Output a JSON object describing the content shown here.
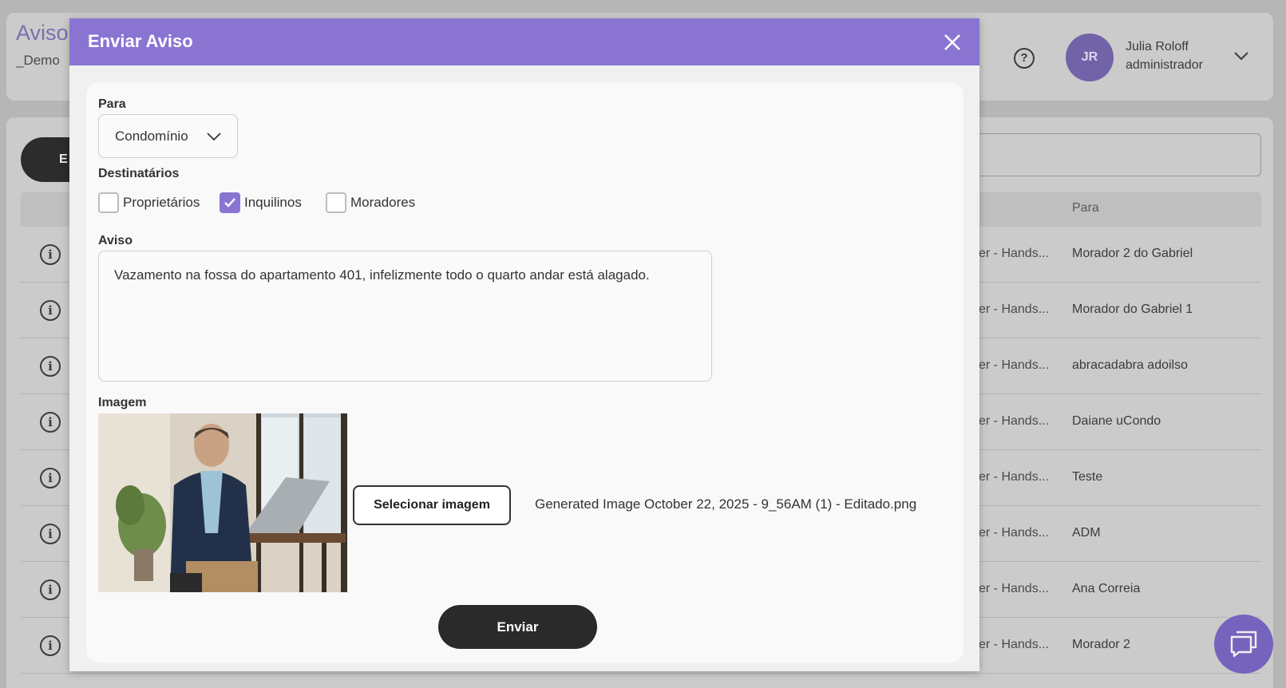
{
  "app": {
    "page_title": "Aviso",
    "subtitle": "_Demo",
    "help_icon": "question-circle-icon",
    "user": {
      "initials": "JR",
      "name": "Julia Roloff",
      "role": "administrador"
    },
    "action_button_label": "E",
    "table": {
      "header_para": "Para",
      "rows": [
        {
          "desc": "er - Hands...",
          "para": "Morador 2 do Gabriel"
        },
        {
          "desc": "er - Hands...",
          "para": "Morador do Gabriel 1"
        },
        {
          "desc": "er - Hands...",
          "para": "abracadabra adoilso"
        },
        {
          "desc": "er - Hands...",
          "para": "Daiane uCondo"
        },
        {
          "desc": "er - Hands...",
          "para": "Teste"
        },
        {
          "desc": "er - Hands...",
          "para": "ADM"
        },
        {
          "desc": "er - Hands...",
          "para": "Ana Correia"
        },
        {
          "desc": "er - Hands...",
          "para": "Morador 2"
        }
      ]
    },
    "chat_icon": "chat-bubbles-icon"
  },
  "modal": {
    "title": "Enviar Aviso",
    "close_icon": "close-icon",
    "para": {
      "label": "Para",
      "value": "Condomínio"
    },
    "destinatarios": {
      "label": "Destinatários",
      "options": [
        {
          "label": "Proprietários",
          "checked": false
        },
        {
          "label": "Inquilinos",
          "checked": true
        },
        {
          "label": "Moradores",
          "checked": false
        }
      ]
    },
    "aviso": {
      "label": "Aviso",
      "value": "Vazamento na fossa do apartamento 401, infelizmente todo o quarto andar está alagado."
    },
    "imagem": {
      "label": "Imagem",
      "button_label": "Selecionar imagem",
      "file_name": "Generated Image October 22, 2025 - 9_56AM (1) - Editado.png"
    },
    "submit_label": "Enviar"
  },
  "colors": {
    "accent": "#8a74d2",
    "avatar": "#7160b0",
    "dark_button": "#2a2a2a"
  }
}
